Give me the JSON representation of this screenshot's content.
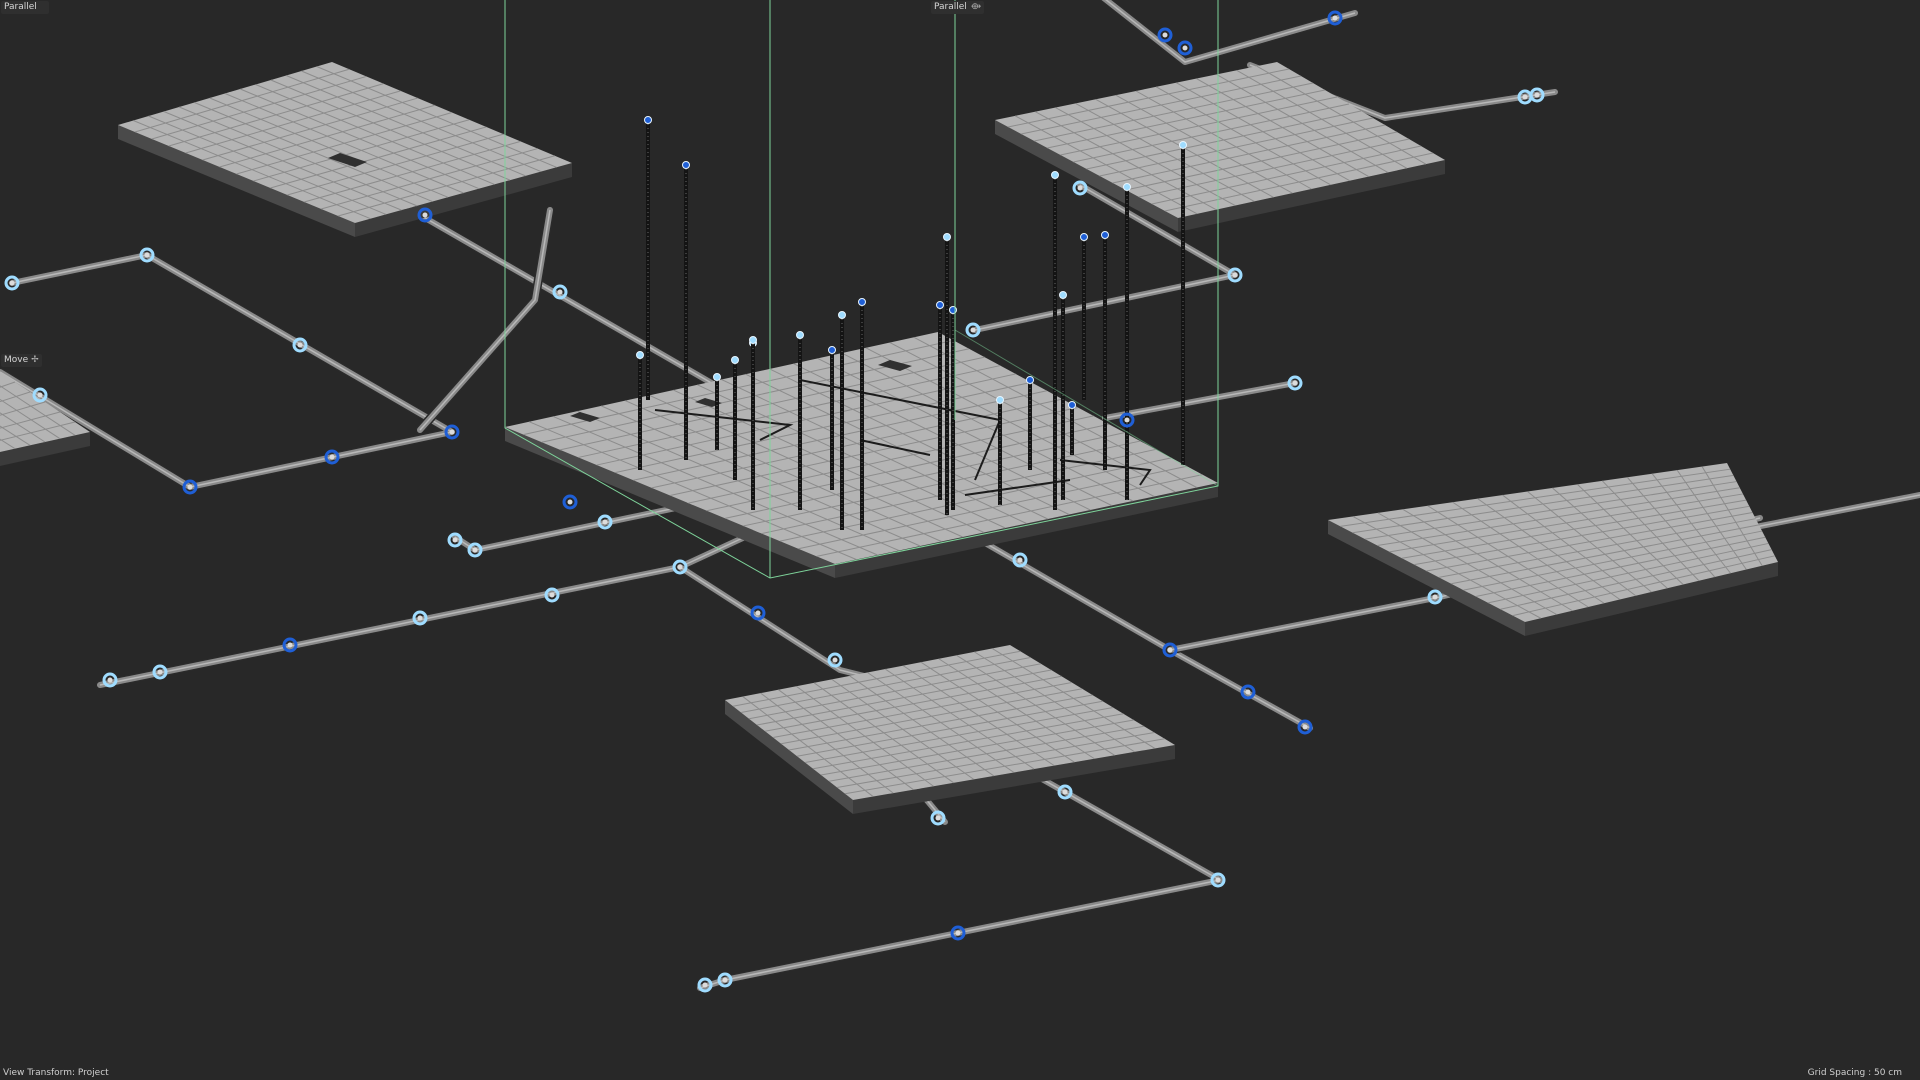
{
  "viewport": {
    "camera_left": "Parallel",
    "camera_right": "Parallel",
    "camera_icon": "camera-icon",
    "tool_label": "Move",
    "tool_icon": "move-arrows-icon"
  },
  "status": {
    "view_transform": "View Transform: Project",
    "grid_spacing": "Grid Spacing : 50 cm"
  },
  "colors": {
    "background": "#282828",
    "slab_top": "#b4b4b4",
    "slab_grid": "#8c8c8c",
    "slab_side": "#4a4a4a",
    "pipe": "#8a8a8a",
    "pipe_dark": "#555555",
    "node_blue": "#1f5fd6",
    "node_light": "#9fdcff",
    "selection_box": "#7ed39a",
    "rebar": "#141414"
  },
  "icons": [
    "camera-icon",
    "move-arrows-icon"
  ]
}
